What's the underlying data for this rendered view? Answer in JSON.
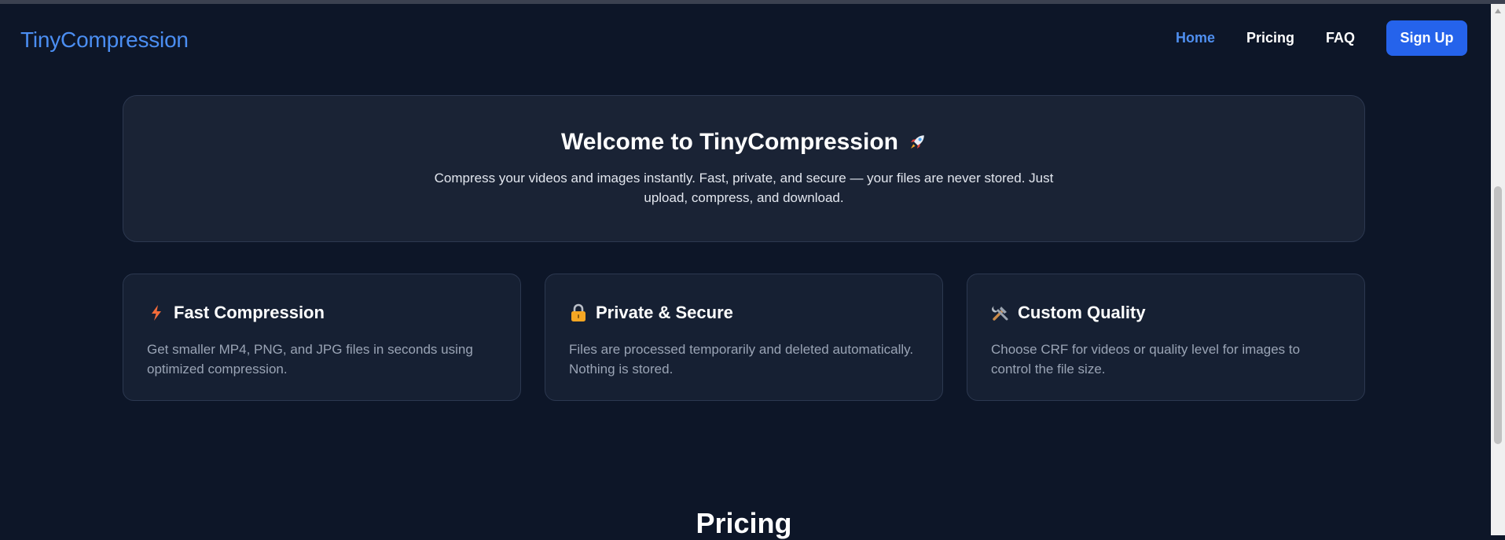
{
  "header": {
    "logo": "TinyCompression",
    "nav": {
      "home": "Home",
      "pricing": "Pricing",
      "faq": "FAQ",
      "signup": "Sign Up"
    }
  },
  "hero": {
    "title": "Welcome to TinyCompression",
    "title_icon": "rocket-icon",
    "description": "Compress your videos and images instantly. Fast, private, and secure — your files are never stored. Just upload, compress, and download."
  },
  "features": [
    {
      "icon": "lightning-icon",
      "title": "Fast Compression",
      "description": "Get smaller MP4, PNG, and JPG files in seconds using optimized compression."
    },
    {
      "icon": "lock-icon",
      "title": "Private & Secure",
      "description": "Files are processed temporarily and deleted automatically. Nothing is stored."
    },
    {
      "icon": "tools-icon",
      "title": "Custom Quality",
      "description": "Choose CRF for videos or quality level for images to control the file size."
    }
  ],
  "pricing": {
    "heading": "Pricing"
  },
  "colors": {
    "background": "#0d1628",
    "accent": "#2563eb",
    "logo": "#4b8ef2",
    "card": "#162033"
  }
}
